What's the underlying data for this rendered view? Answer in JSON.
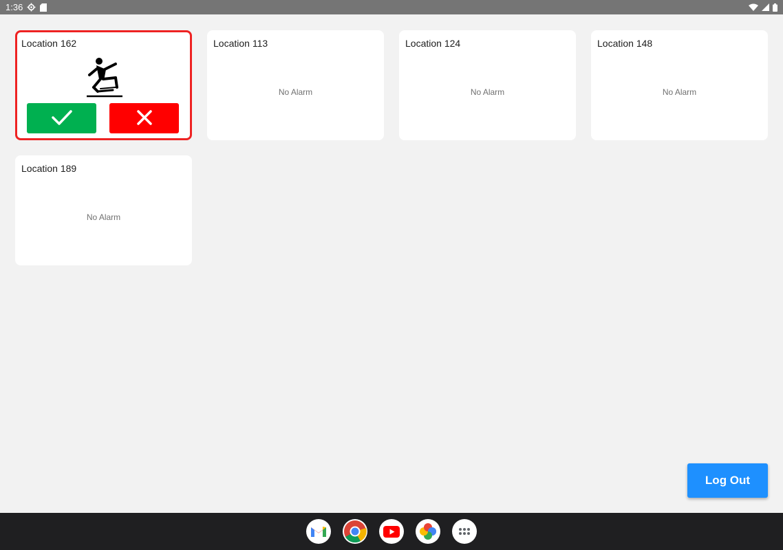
{
  "status_bar": {
    "time": "1:36",
    "icons": [
      "settings-gear-icon",
      "sd-card-icon",
      "wifi-icon",
      "cell-signal-icon",
      "battery-icon"
    ]
  },
  "cards": [
    {
      "title": "Location 162",
      "alarm": true,
      "alarm_icon": "person-falling-icon",
      "accept_icon": "checkmark-icon",
      "reject_icon": "close-icon"
    },
    {
      "title": "Location 113",
      "status": "No Alarm"
    },
    {
      "title": "Location 124",
      "status": "No Alarm"
    },
    {
      "title": "Location 148",
      "status": "No Alarm"
    },
    {
      "title": "Location 189",
      "status": "No Alarm"
    }
  ],
  "logout_label": "Log Out",
  "taskbar": {
    "apps": [
      "gmail-icon",
      "chrome-icon",
      "youtube-icon",
      "photos-icon",
      "app-drawer-icon"
    ]
  },
  "colors": {
    "alarm_border": "#ee2222",
    "accept": "#00b050",
    "reject": "#ff0000",
    "logout": "#1e90ff"
  }
}
